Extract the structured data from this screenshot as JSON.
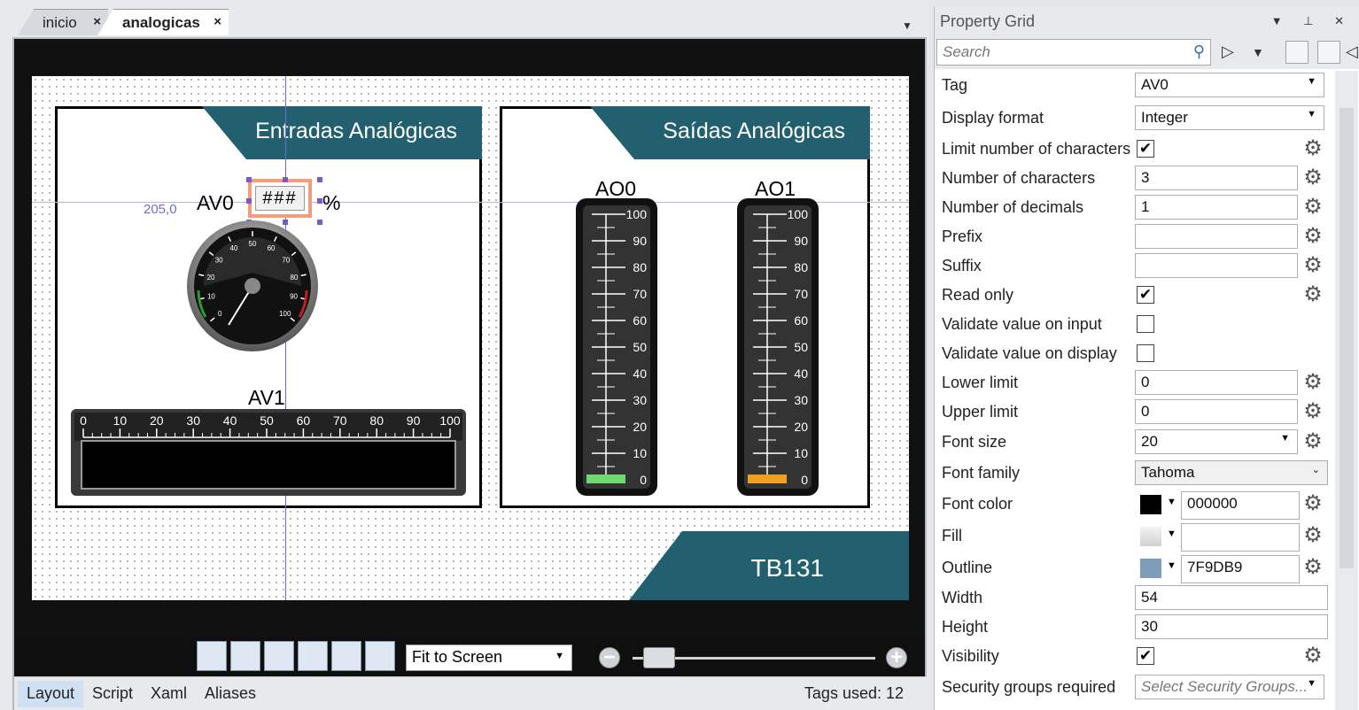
{
  "tabs": [
    {
      "label": "inicio",
      "close": "×"
    },
    {
      "label": "analogicas",
      "close": "×"
    }
  ],
  "canvas": {
    "inputs_title": "Entradas Analógicas",
    "outputs_title": "Saídas Analógicas",
    "footer_title": "TB131",
    "av0_label": "AV0",
    "av0_display": "###",
    "av0_unit": "%",
    "av1_label": "AV1",
    "ao0_label": "AO0",
    "ao1_label": "AO1",
    "guide_coord": "205,0",
    "gauge_ticks": [
      "0",
      "10",
      "20",
      "30",
      "40",
      "50",
      "60",
      "70",
      "80",
      "90",
      "100"
    ],
    "bar_ticks": [
      "0",
      "10",
      "20",
      "30",
      "40",
      "50",
      "60",
      "70",
      "80",
      "90",
      "100"
    ],
    "tank_ticks": [
      "100",
      "90",
      "80",
      "70",
      "60",
      "50",
      "40",
      "30",
      "20",
      "10",
      "0"
    ],
    "ao0_fill_color": "#6fd86f",
    "ao1_fill_color": "#f0a020"
  },
  "toolbar": {
    "zoom_mode": "Fit to Screen",
    "zoom_out": "−",
    "zoom_in": "+"
  },
  "bottom_tabs": [
    "Layout",
    "Script",
    "Xaml",
    "Aliases"
  ],
  "tags_used": "Tags used: 12",
  "property_grid": {
    "title": "Property Grid",
    "search_placeholder": "Search",
    "rows": [
      {
        "name": "Tag",
        "value": "AV0"
      },
      {
        "name": "Display format",
        "value": "Integer"
      },
      {
        "name": "Limit number of characters",
        "value": "✔"
      },
      {
        "name": "Number of characters",
        "value": "3"
      },
      {
        "name": "Number of decimals",
        "value": "1"
      },
      {
        "name": "Prefix",
        "value": ""
      },
      {
        "name": "Suffix",
        "value": ""
      },
      {
        "name": "Read only",
        "value": "✔"
      },
      {
        "name": "Validate value on input",
        "value": ""
      },
      {
        "name": "Validate value on display",
        "value": ""
      },
      {
        "name": "Lower limit",
        "value": "0"
      },
      {
        "name": "Upper limit",
        "value": "0"
      },
      {
        "name": "Font size",
        "value": "20"
      },
      {
        "name": "Font family",
        "value": "Tahoma"
      },
      {
        "name": "Font color",
        "value": "000000"
      },
      {
        "name": "Fill",
        "value": ""
      },
      {
        "name": "Outline",
        "value": "7F9DB9"
      },
      {
        "name": "Width",
        "value": "54"
      },
      {
        "name": "Height",
        "value": "30"
      },
      {
        "name": "Visibility",
        "value": "✔"
      },
      {
        "name": "Security groups required",
        "value": "Select Security Groups..."
      }
    ]
  },
  "colors": {
    "header_teal": "#23606f",
    "font_color_swatch": "#000000",
    "outline_swatch": "#7F9DB9"
  }
}
